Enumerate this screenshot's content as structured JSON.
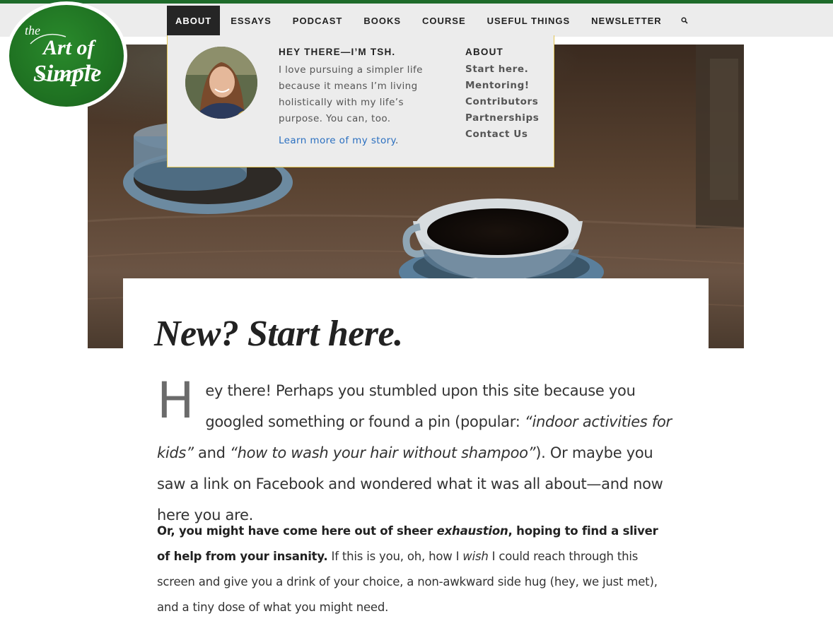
{
  "nav": {
    "items": [
      "ABOUT",
      "ESSAYS",
      "PODCAST",
      "BOOKS",
      "COURSE",
      "USEFUL THINGS",
      "NEWSLETTER"
    ],
    "active": "ABOUT",
    "search_icon": "search-icon"
  },
  "logo": {
    "text": "the Art of Simple",
    "color": "#1f7222"
  },
  "dropdown": {
    "intro_title": "HEY THERE—I’M TSH.",
    "intro_text": "I love pursuing a simpler life because it means I’m living holistically with my life’s purpose. You can, too.",
    "learn_link": "Learn more of my story",
    "learn_suffix": ".",
    "about_title": "ABOUT",
    "about_links": [
      "Start here.",
      "Mentoring!",
      "Contributors",
      "Partnerships",
      "Contact Us"
    ]
  },
  "page": {
    "title": "New? Start here.",
    "lead": {
      "dropcap": "H",
      "part1": "ey there! Perhaps you stumbled upon this site because you googled something or found a pin (popular: ",
      "em1": "“indoor activities for kids”",
      "part2": " and ",
      "em2": "“how to wash your hair without shampoo”",
      "part3": "). Or maybe you saw a link on Facebook and wondered what it was all about—and now here you are."
    },
    "para2": {
      "bold1": "Or, you might have come here out of sheer ",
      "bold_em": "exhaustion",
      "bold2": ", hoping to find a sliver of help from your insanity.",
      "text1": " If this is you, oh, how I ",
      "em": "wish",
      "text2": " I could reach through this screen and give you a drink of your choice, a non-awkward side hug (hey, we just met), and a tiny dose of what you might need."
    }
  },
  "colors": {
    "brand_green": "#1f7222",
    "link_blue": "#2a6fc0",
    "nav_active_bg": "#252525",
    "dropdown_border": "#e3c652"
  }
}
